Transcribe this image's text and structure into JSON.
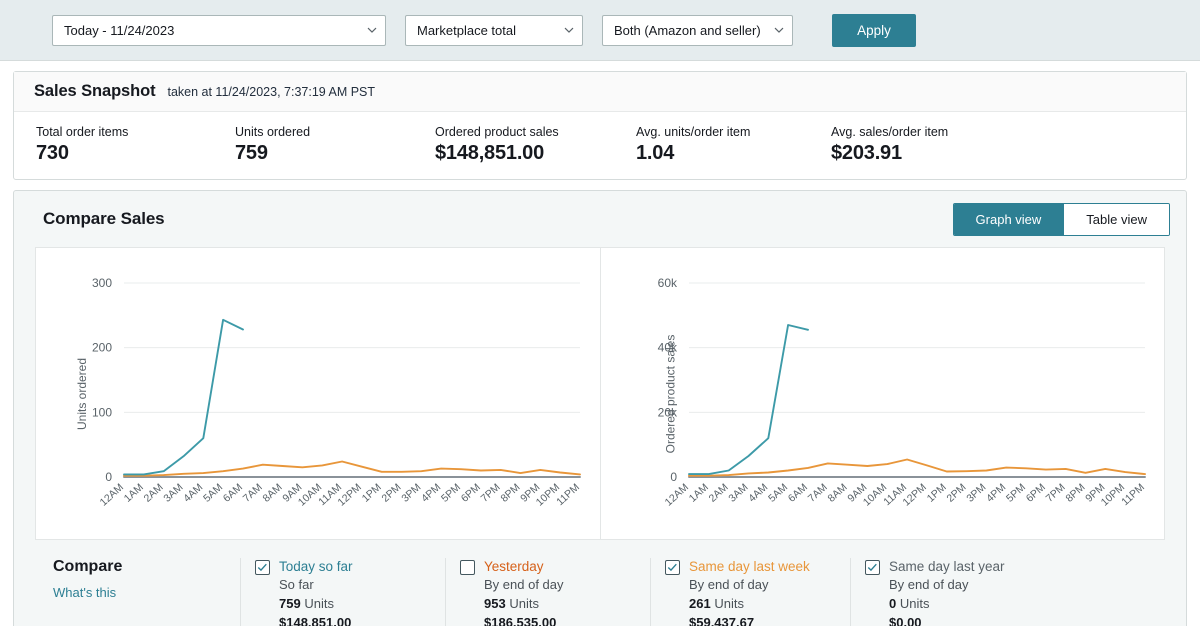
{
  "filters": {
    "date_range": "Today - 11/24/2023",
    "marketplace": "Marketplace total",
    "fulfillment": "Both (Amazon and seller)",
    "apply_label": "Apply"
  },
  "snapshot": {
    "title": "Sales Snapshot",
    "subtitle": "taken at 11/24/2023, 7:37:19 AM PST",
    "metrics": [
      {
        "label": "Total order items",
        "value": "730"
      },
      {
        "label": "Units ordered",
        "value": "759"
      },
      {
        "label": "Ordered product sales",
        "value": "$148,851.00"
      },
      {
        "label": "Avg. units/order item",
        "value": "1.04"
      },
      {
        "label": "Avg. sales/order item",
        "value": "$203.91"
      }
    ]
  },
  "compare": {
    "title": "Compare Sales",
    "graph_view_label": "Graph view",
    "table_view_label": "Table view",
    "compare_label": "Compare",
    "whats_this_label": "What's this",
    "legend": [
      {
        "name": "Today so far",
        "sub": "So far",
        "units": "759",
        "units_word": "Units",
        "money": "$148,851.00",
        "checked": true,
        "color": "#2d7f93"
      },
      {
        "name": "Yesterday",
        "sub": "By end of day",
        "units": "953",
        "units_word": "Units",
        "money": "$186,535.00",
        "checked": false,
        "color": "#d6611a"
      },
      {
        "name": "Same day last week",
        "sub": "By end of day",
        "units": "261",
        "units_word": "Units",
        "money": "$59,437.67",
        "checked": true,
        "color": "#e8963a"
      },
      {
        "name": "Same day last year",
        "sub": "By end of day",
        "units": "0",
        "units_word": "Units",
        "money": "$0.00",
        "checked": true,
        "color": "#5a6369"
      }
    ]
  },
  "chart_data": [
    {
      "type": "line",
      "title": "",
      "ylabel": "Units ordered",
      "xlabel": "",
      "ylim": [
        0,
        320
      ],
      "yticks": [
        0,
        100,
        200,
        300
      ],
      "ytick_labels": [
        "0",
        "100",
        "200",
        "300"
      ],
      "grid": true,
      "legend_position": "below",
      "categories": [
        "12AM",
        "1AM",
        "2AM",
        "3AM",
        "4AM",
        "5AM",
        "6AM",
        "7AM",
        "8AM",
        "9AM",
        "10AM",
        "11AM",
        "12PM",
        "1PM",
        "2PM",
        "3PM",
        "4PM",
        "5PM",
        "6PM",
        "7PM",
        "8PM",
        "9PM",
        "10PM",
        "11PM"
      ],
      "series": [
        {
          "name": "Today so far",
          "color": "#3d9aa8",
          "values": [
            4,
            4,
            9,
            32,
            60,
            243,
            228,
            null,
            null,
            null,
            null,
            null,
            null,
            null,
            null,
            null,
            null,
            null,
            null,
            null,
            null,
            null,
            null,
            null
          ]
        },
        {
          "name": "Same day last week",
          "color": "#e8963a",
          "values": [
            2,
            2,
            3,
            5,
            6,
            9,
            13,
            19,
            17,
            15,
            18,
            24,
            16,
            8,
            8,
            9,
            13,
            12,
            10,
            11,
            6,
            11,
            7,
            4
          ]
        },
        {
          "name": "Same day last year",
          "color": "#8a9299",
          "values": [
            0,
            0,
            0,
            0,
            0,
            0,
            0,
            0,
            0,
            0,
            0,
            0,
            0,
            0,
            0,
            0,
            0,
            0,
            0,
            0,
            0,
            0,
            0,
            0
          ]
        }
      ]
    },
    {
      "type": "line",
      "title": "",
      "ylabel": "Ordered product sales",
      "xlabel": "",
      "ylim": [
        0,
        64000
      ],
      "yticks": [
        0,
        20000,
        40000,
        60000
      ],
      "ytick_labels": [
        "0",
        "20k",
        "40k",
        "60k"
      ],
      "grid": true,
      "legend_position": "below",
      "categories": [
        "12AM",
        "1AM",
        "2AM",
        "3AM",
        "4AM",
        "5AM",
        "6AM",
        "7AM",
        "8AM",
        "9AM",
        "10AM",
        "11AM",
        "12PM",
        "1PM",
        "2PM",
        "3PM",
        "4PM",
        "5PM",
        "6PM",
        "7PM",
        "8PM",
        "9PM",
        "10PM",
        "11PM"
      ],
      "series": [
        {
          "name": "Today so far",
          "color": "#3d9aa8",
          "values": [
            900,
            900,
            2000,
            6500,
            12000,
            47000,
            45500,
            null,
            null,
            null,
            null,
            null,
            null,
            null,
            null,
            null,
            null,
            null,
            null,
            null,
            null,
            null,
            null,
            null
          ]
        },
        {
          "name": "Same day last week",
          "color": "#e8963a",
          "values": [
            400,
            400,
            600,
            1100,
            1400,
            2000,
            2800,
            4200,
            3800,
            3400,
            4000,
            5400,
            3600,
            1700,
            1800,
            2000,
            2900,
            2700,
            2300,
            2500,
            1300,
            2500,
            1500,
            900
          ]
        },
        {
          "name": "Same day last year",
          "color": "#8a9299",
          "values": [
            0,
            0,
            0,
            0,
            0,
            0,
            0,
            0,
            0,
            0,
            0,
            0,
            0,
            0,
            0,
            0,
            0,
            0,
            0,
            0,
            0,
            0,
            0,
            0
          ]
        }
      ]
    }
  ]
}
